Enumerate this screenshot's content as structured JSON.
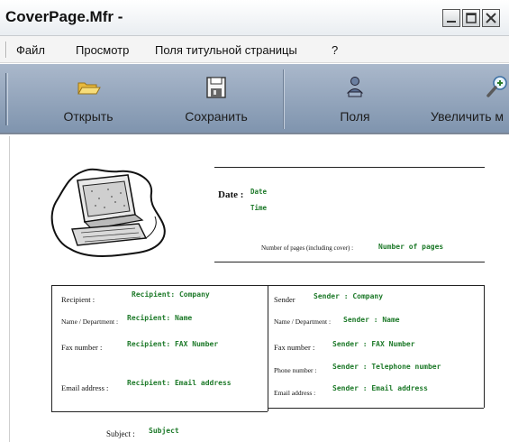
{
  "window": {
    "title": "CoverPage.Mfr -"
  },
  "menu": {
    "items": [
      "Файл",
      "Просмотр",
      "Поля титульной страницы",
      "?"
    ]
  },
  "toolbar": {
    "open_label": "Открыть",
    "save_label": "Сохранить",
    "fields_label": "Поля",
    "zoom_label": "Увеличить м"
  },
  "cover": {
    "date_label": "Date :",
    "date_field": "Date",
    "time_field": "Time",
    "pages_label": "Number of pages (including cover) :",
    "pages_field": "Number of pages",
    "recipient": {
      "company_label": "Recipient :",
      "company_field": "Recipient: Company",
      "name_label": "Name / Department :",
      "name_field": "Recipient: Name",
      "fax_label": "Fax number :",
      "fax_field": "Recipient: FAX Number",
      "email_label": "Email address :",
      "email_field": "Recipient: Email address"
    },
    "sender": {
      "company_label": "Sender",
      "company_field": "Sender : Company",
      "name_label": "Name / Department :",
      "name_field": "Sender : Name",
      "fax_label": "Fax number :",
      "fax_field": "Sender : FAX Number",
      "phone_label": "Phone number :",
      "phone_field": "Sender : Telephone number",
      "email_label": "Email address :",
      "email_field": "Sender : Email address"
    },
    "subject_label": "Subject :",
    "subject_field": "Subject"
  }
}
